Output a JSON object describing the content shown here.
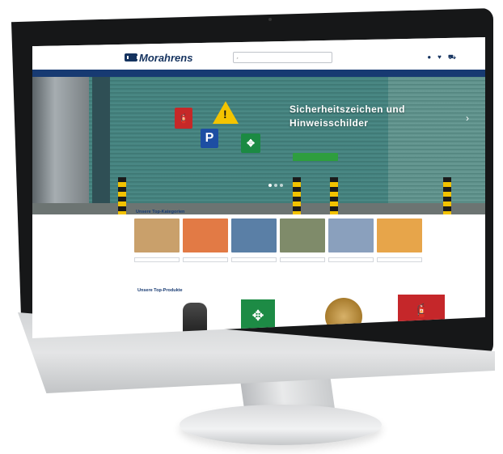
{
  "topbar": {
    "items": [
      "",
      "",
      "",
      ""
    ],
    "phone": ""
  },
  "header": {
    "logo_text": "Morahrens",
    "search_placeholder": "",
    "icons": [
      "user-icon",
      "heart-icon",
      "cart-icon"
    ]
  },
  "nav": {
    "items": [
      "",
      "",
      "",
      "",
      ""
    ]
  },
  "hero": {
    "title_line1": "Sicherheitszeichen und",
    "title_line2": "Hinweisschilder",
    "button_label": ""
  },
  "categories": {
    "title": "Unsere Top-Kategorien",
    "items": [
      {
        "label": "",
        "color": "#c9a06b"
      },
      {
        "label": "",
        "color": "#e27a45"
      },
      {
        "label": "",
        "color": "#5a7fa6"
      },
      {
        "label": "",
        "color": "#7f8b6a"
      },
      {
        "label": "",
        "color": "#8aa0bd"
      },
      {
        "label": "",
        "color": "#e7a54a"
      }
    ]
  },
  "products": {
    "title": "Unsere Top-Produkte"
  },
  "colors": {
    "brand": "#15335f",
    "nav": "#173a72",
    "cta": "#2e9e3e"
  }
}
